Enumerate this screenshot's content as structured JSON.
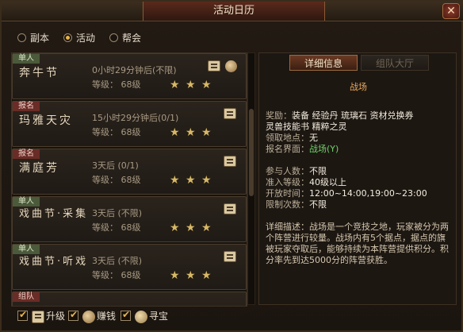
{
  "window": {
    "title": "活动日历",
    "close_label": "✕"
  },
  "filters": {
    "radios": [
      {
        "label": "副本",
        "selected": false
      },
      {
        "label": "活动",
        "selected": true
      },
      {
        "label": "帮会",
        "selected": false
      }
    ]
  },
  "activities": [
    {
      "tag": "单人",
      "name": "奔牛节",
      "time": "0小时29分钟后(不限)",
      "level": "等级：  68级",
      "stars": 3
    },
    {
      "tag": "报名",
      "name": "玛雅天灾",
      "time": "15小时29分钟后(0/1)",
      "level": "等级：  68级",
      "stars": 3
    },
    {
      "tag": "报名",
      "name": "满庭芳",
      "time": "3天后 (0/1)",
      "level": "等级：  68级",
      "stars": 3
    },
    {
      "tag": "单人",
      "name": "戏曲节·采集",
      "time": "3天后 (不限)",
      "level": "等级：  68级",
      "stars": 3
    },
    {
      "tag": "单人",
      "name": "戏曲节·听戏",
      "time": "3天后 (不限)",
      "level": "等级：  68级",
      "stars": 3
    },
    {
      "tag": "组队",
      "name": "",
      "time": "",
      "level": "",
      "stars": 0
    }
  ],
  "checkboxes": [
    {
      "label": "升级",
      "icon": "upgrade-icon",
      "checked": true
    },
    {
      "label": "赚钱",
      "icon": "money-bag-icon",
      "checked": true
    },
    {
      "label": "寻宝",
      "icon": "treasure-icon",
      "checked": true
    }
  ],
  "detail": {
    "tabs": [
      {
        "label": "详细信息",
        "active": true
      },
      {
        "label": "组队大厅",
        "active": false
      }
    ],
    "title": "战场",
    "rewards_label": "奖励：",
    "rewards_value": "装备  经验丹  琉璃石  资材兑换券",
    "rewards_value2": "灵兽技能书  精粹之灵",
    "location_label": "领取地点：",
    "location_value": "无",
    "signup_label": "报名界面：",
    "signup_value": "战场(Y)",
    "participants_label": "参与人数：",
    "participants_value": "不限",
    "level_label": "准入等级：",
    "level_value": "40级以上",
    "open_label": "开放时间：",
    "open_value": "12:00~14:00,19:00~23:00",
    "limit_label": "限制次数：",
    "limit_value": "不限",
    "desc_label": "详细描述：",
    "description": "战场是一个竞技之地，玩家被分为两个阵营进行较量。战场内有5个据点，据点的旗被玩家夺取后，能够持续为本阵营提供积分。积分率先到达5000分的阵营获胜。"
  },
  "colors": {
    "accent": "#e7b54c",
    "title_orange": "#e9a85c",
    "link_green": "#6fd06a",
    "star_gold": "#d7b865"
  }
}
